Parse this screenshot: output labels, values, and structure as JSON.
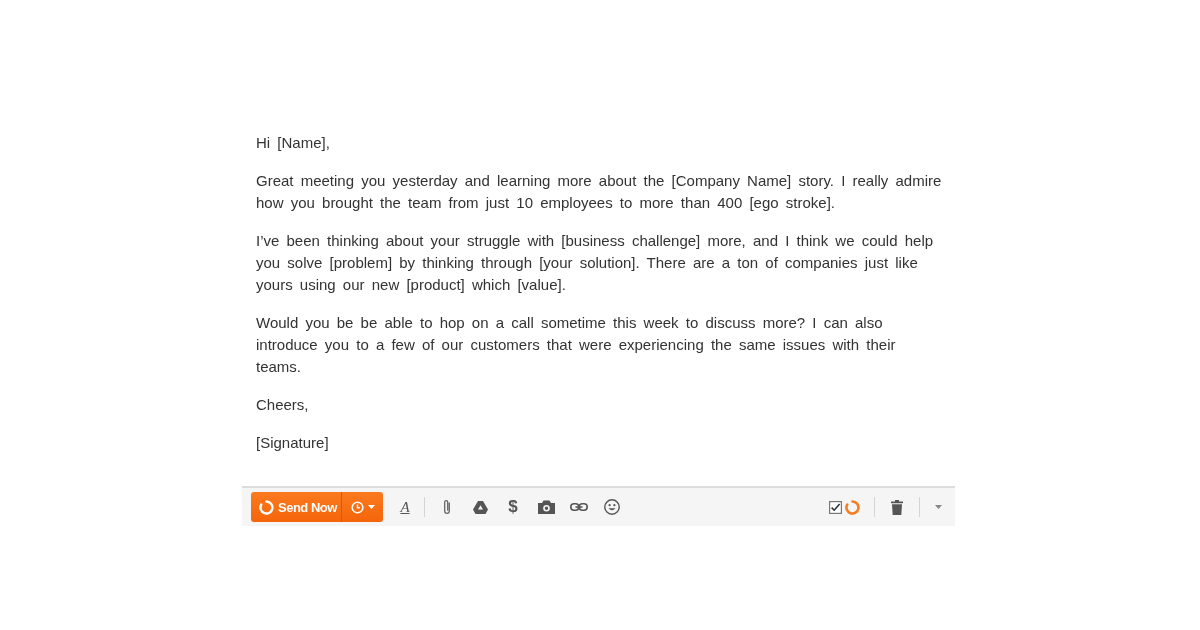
{
  "email": {
    "paragraphs": [
      "Hi [Name],",
      "Great meeting you yesterday and learning more about the [Company Name] story. I really admire how you brought the team from just 10 employees to more than 400 [ego stroke].",
      "I’ve been thinking about your struggle with [business challenge] more, and I think we could help you solve [problem] by thinking through [your solution]. There are a ton of companies just like yours using our new [product] which [value].",
      "Would you be be able to hop on a call sometime this week to discuss more? I can also introduce you to a few of our customers that were experiencing the same issues with their teams.",
      "Cheers,",
      "[Signature]"
    ]
  },
  "toolbar": {
    "send_button": {
      "label": "Send Now"
    },
    "tools": [
      {
        "kind": "format",
        "glyph": "A"
      },
      {
        "kind": "attach"
      },
      {
        "kind": "drive"
      },
      {
        "kind": "money",
        "glyph": "$"
      },
      {
        "kind": "photo"
      },
      {
        "kind": "link"
      },
      {
        "kind": "emoji"
      }
    ],
    "tracking": {
      "checked": true
    }
  }
}
